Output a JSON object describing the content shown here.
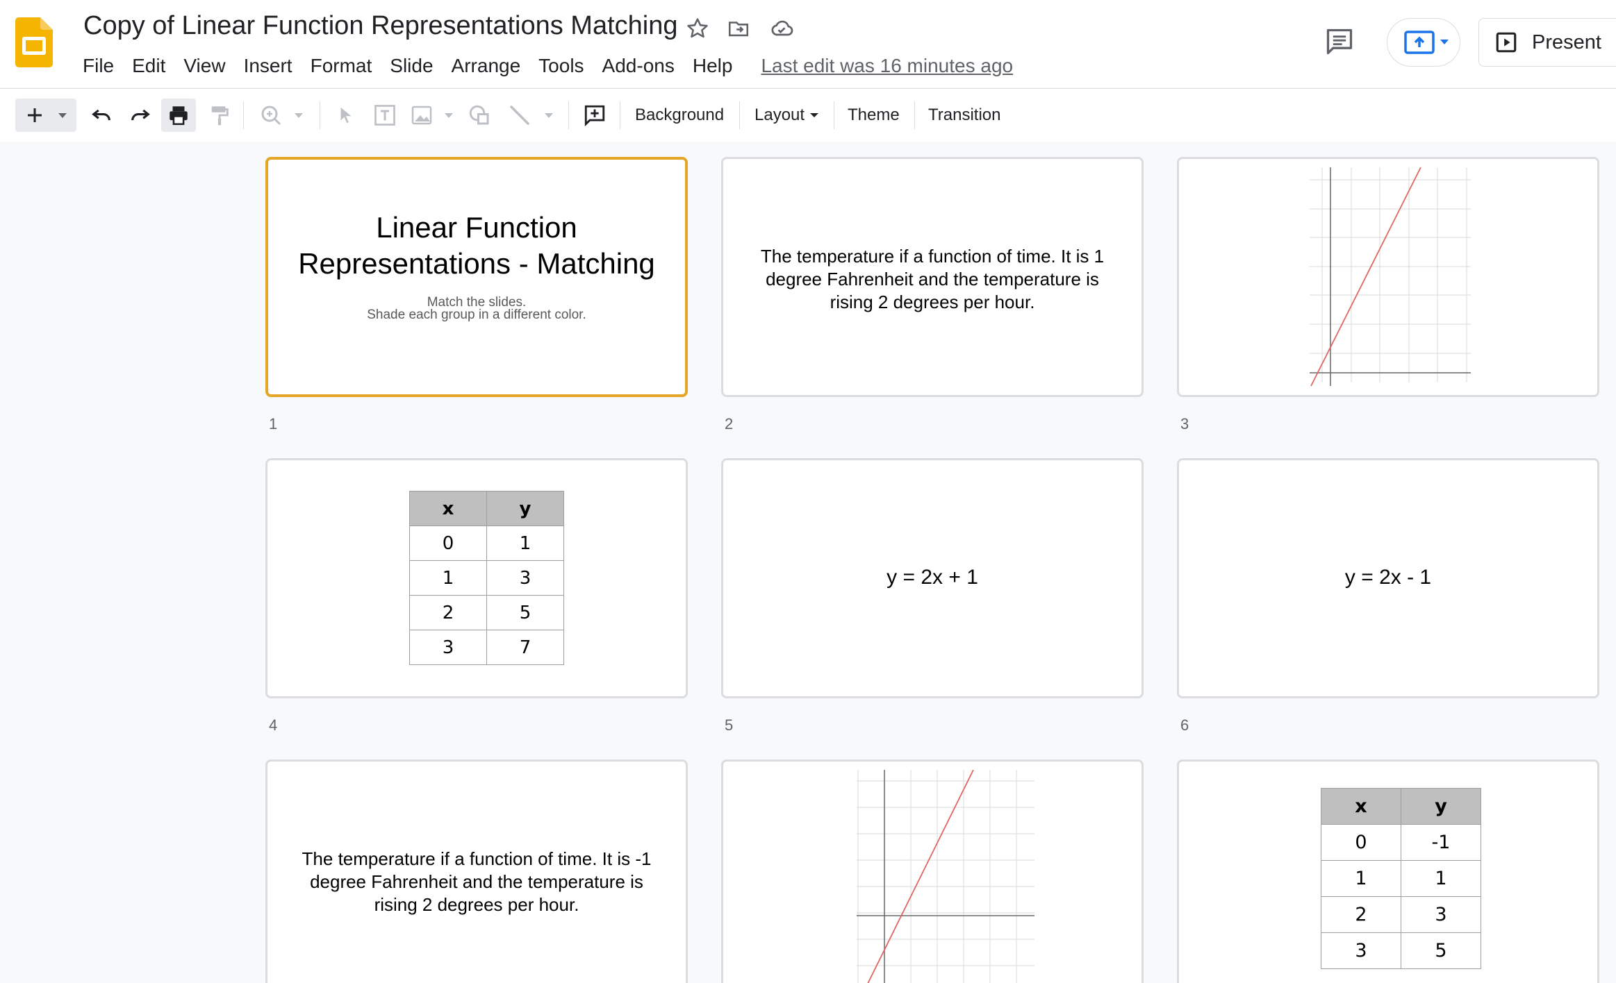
{
  "app": {
    "title": "Copy of Linear Function Representations Matching",
    "last_edit": "Last edit was 16 minutes ago",
    "menu": [
      "File",
      "Edit",
      "View",
      "Insert",
      "Format",
      "Slide",
      "Arrange",
      "Tools",
      "Add-ons",
      "Help"
    ],
    "present_label": "Present"
  },
  "toolbar": {
    "background_label": "Background",
    "layout_label": "Layout",
    "theme_label": "Theme",
    "transition_label": "Transition"
  },
  "slides": {
    "s1": {
      "number": "1",
      "title_line1": "Linear Function",
      "title_line2": "Representations - Matching",
      "subtitle_line1": "Match the slides.",
      "subtitle_line2": "Shade each group in a different color."
    },
    "s2": {
      "number": "2",
      "line1": "The temperature if a function of time. It is 1",
      "line2": "degree Fahrenheit and the temperature is",
      "line3": "rising 2 degrees per hour."
    },
    "s3": {
      "number": "3"
    },
    "s4": {
      "number": "4",
      "table": {
        "headers": [
          "x",
          "y"
        ],
        "rows": [
          [
            "0",
            "1"
          ],
          [
            "1",
            "3"
          ],
          [
            "2",
            "5"
          ],
          [
            "3",
            "7"
          ]
        ]
      }
    },
    "s5": {
      "number": "5",
      "equation": "y = 2x + 1"
    },
    "s6": {
      "number": "6",
      "equation": "y = 2x - 1"
    },
    "s7": {
      "line1": "The temperature if a function of time. It is -1",
      "line2": "degree Fahrenheit and the temperature is",
      "line3": "rising 2 degrees per hour."
    },
    "s8": {},
    "s9": {
      "table": {
        "headers": [
          "x",
          "y"
        ],
        "rows": [
          [
            "0",
            "-1"
          ],
          [
            "1",
            "1"
          ],
          [
            "2",
            "3"
          ],
          [
            "3",
            "5"
          ]
        ]
      }
    }
  },
  "colors": {
    "selected_border": "#e5a527",
    "graph_line": "#e06666",
    "slides_brand": "#f4b400"
  }
}
